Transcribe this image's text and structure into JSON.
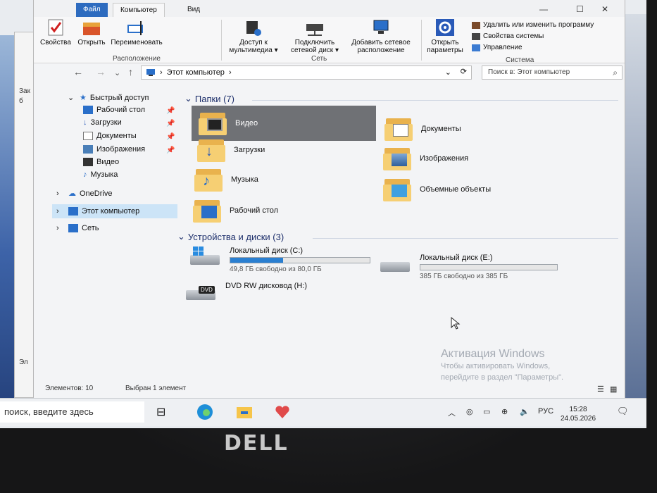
{
  "ribbon": {
    "tab_file": "Файл",
    "tab_computer": "Компьютер",
    "tab_view": "Вид",
    "properties": "Свойства",
    "open": "Открыть",
    "rename": "Переименовать",
    "location_group": "Расположение",
    "media_access_1": "Доступ к",
    "media_access_2": "мультимедиа ▾",
    "map_drive_1": "Подключить",
    "map_drive_2": "сетевой диск ▾",
    "add_location_1": "Добавить сетевое",
    "add_location_2": "расположение",
    "network_group": "Сеть",
    "open_settings_1": "Открыть",
    "open_settings_2": "параметры",
    "uninstall": "Удалить или изменить программу",
    "system_props": "Свойства системы",
    "manage": "Управление",
    "system_group": "Система"
  },
  "address": {
    "path_root": "›",
    "path": "Этот компьютер",
    "path_arrow": "›",
    "search_placeholder": "Поиск в: Этот компьютер"
  },
  "nav": {
    "quick_access": "Быстрый доступ",
    "desktop": "Рабочий стол",
    "downloads": "Загрузки",
    "documents": "Документы",
    "pictures": "Изображения",
    "video": "Видео",
    "music": "Музыка",
    "onedrive": "OneDrive",
    "this_pc": "Этот компьютер",
    "network": "Сеть"
  },
  "folders_header": "Папки (7)",
  "folders": {
    "video": "Видео",
    "documents": "Документы",
    "downloads": "Загрузки",
    "pictures": "Изображения",
    "music": "Музыка",
    "objects3d": "Объемные объекты",
    "desktop": "Рабочий стол"
  },
  "devices_header": "Устройства и диски (3)",
  "drives": [
    {
      "name": "Локальный диск (C:)",
      "free": "49,8 ГБ свободно из 80,0 ГБ",
      "used_fraction": 0.38
    },
    {
      "name": "Локальный диск (E:)",
      "free": "385 ГБ свободно из 385 ГБ",
      "used_fraction": 0.0
    },
    {
      "name": "DVD RW дисковод (H:)"
    }
  ],
  "dvd_badge": "DVD",
  "watermark": {
    "line1": "Активация Windows",
    "line2": "Чтобы активировать Windows,",
    "line3": "перейдите в раздел \"Параметры\"."
  },
  "status": {
    "items": "Элементов: 10",
    "selected": "Выбран 1 элемент"
  },
  "taskbar": {
    "search_placeholder": "поиск, введите здесь",
    "language": "РУС",
    "time": "15:28",
    "date": "24.05.2026"
  },
  "bg_window": {
    "t1": "Зак",
    "t2": "б",
    "t3": "Эл"
  },
  "brand": "DELL",
  "colors": {
    "accent": "#2a7fd1",
    "selection": "#cce4f7",
    "folder": "#f6cf73"
  }
}
